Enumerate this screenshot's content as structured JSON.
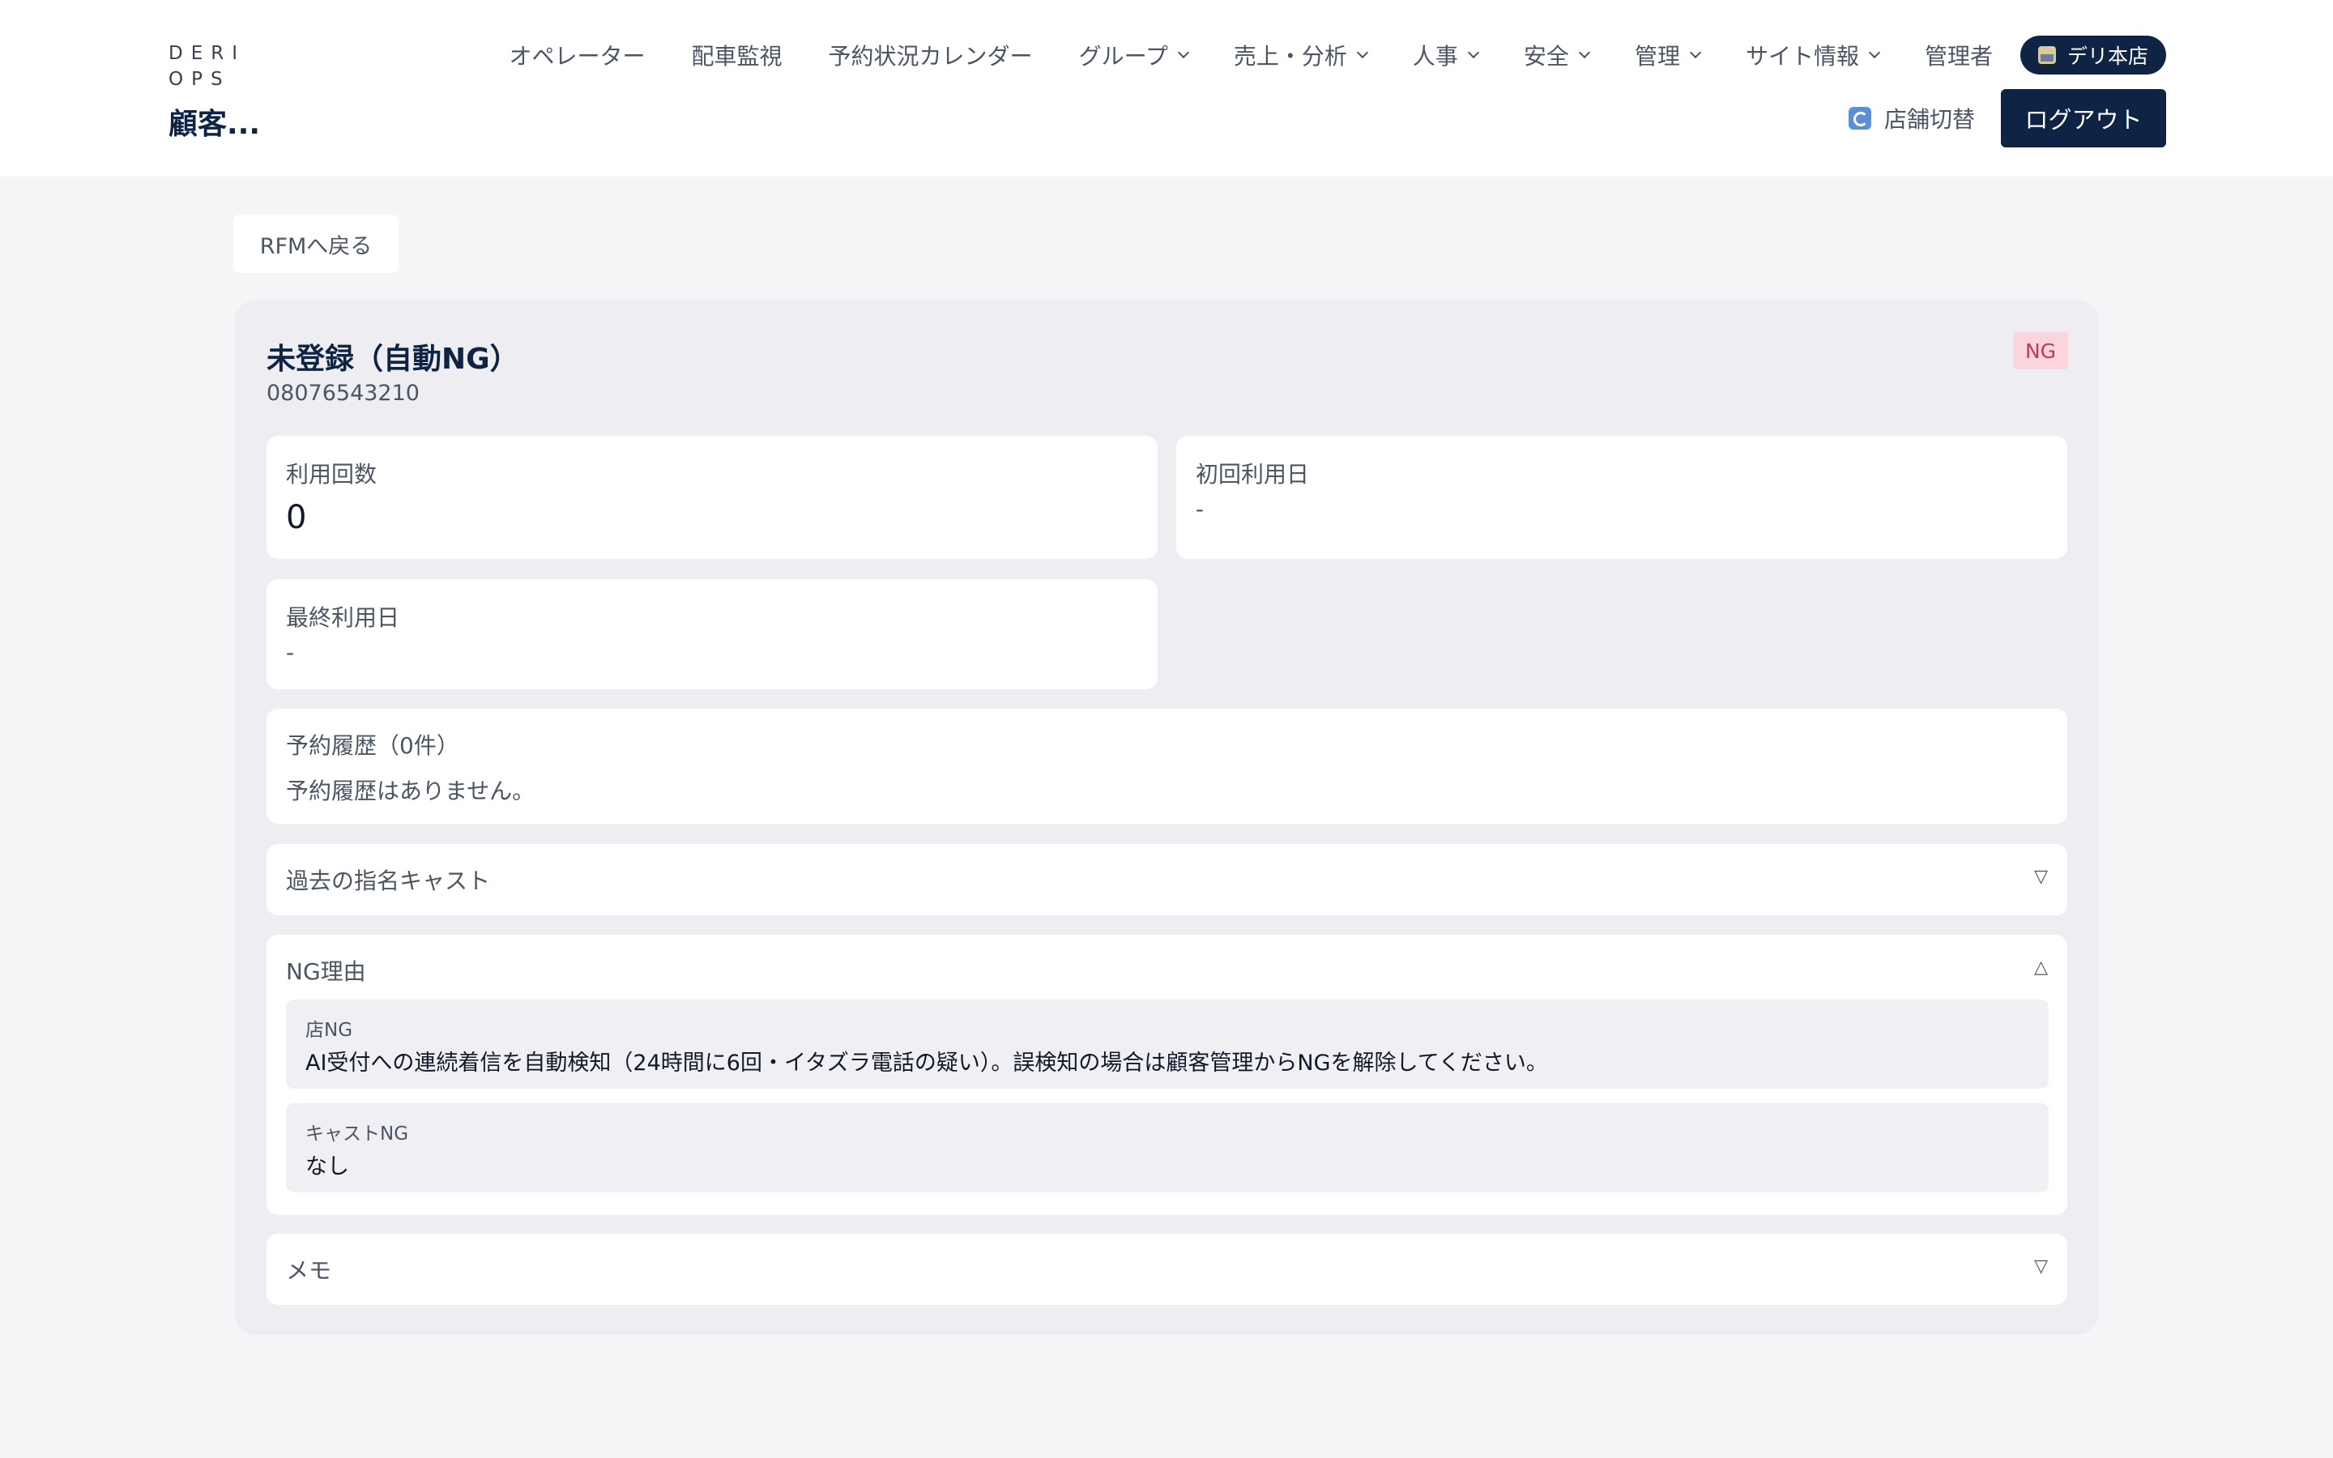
{
  "brand": {
    "small": "DERI OPS",
    "title": "顧客..."
  },
  "nav": {
    "items": [
      {
        "label": "オペレーター",
        "dropdown": false
      },
      {
        "label": "配車監視",
        "dropdown": false
      },
      {
        "label": "予約状況カレンダー",
        "dropdown": false
      },
      {
        "label": "グループ",
        "dropdown": true
      },
      {
        "label": "売上・分析",
        "dropdown": true
      },
      {
        "label": "人事",
        "dropdown": true
      },
      {
        "label": "安全",
        "dropdown": true
      },
      {
        "label": "管理",
        "dropdown": true
      },
      {
        "label": "サイト情報",
        "dropdown": true
      },
      {
        "label": "管理者",
        "dropdown": false
      }
    ],
    "store_badge": "デリ本店",
    "switch_store": "店舗切替",
    "logout": "ログアウト"
  },
  "back_button": "RFMへ戻る",
  "customer": {
    "name": "未登録（自動NG）",
    "phone": "08076543210",
    "badge": "NG"
  },
  "stats": {
    "usage_count_label": "利用回数",
    "usage_count": "0",
    "first_use_label": "初回利用日",
    "first_use": "-",
    "last_use_label": "最終利用日",
    "last_use": "-"
  },
  "history": {
    "title": "予約履歴（0件）",
    "empty": "予約履歴はありません。"
  },
  "past_casts": {
    "title": "過去の指名キャスト",
    "toggle": "▽"
  },
  "ng_reasons": {
    "title": "NG理由",
    "toggle": "△",
    "store_label": "店NG",
    "store_text": "AI受付への連続着信を自動検知（24時間に6回・イタズラ電話の疑い）。誤検知の場合は顧客管理からNGを解除してください。",
    "cast_label": "キャストNG",
    "cast_text": "なし"
  },
  "memo": {
    "title": "メモ",
    "toggle": "▽"
  },
  "colors": {
    "navy": "#0f2344",
    "ng_badge_bg": "#fbd5dd",
    "ng_badge_text": "#be3a54",
    "page_bg": "#f5f5f8"
  }
}
